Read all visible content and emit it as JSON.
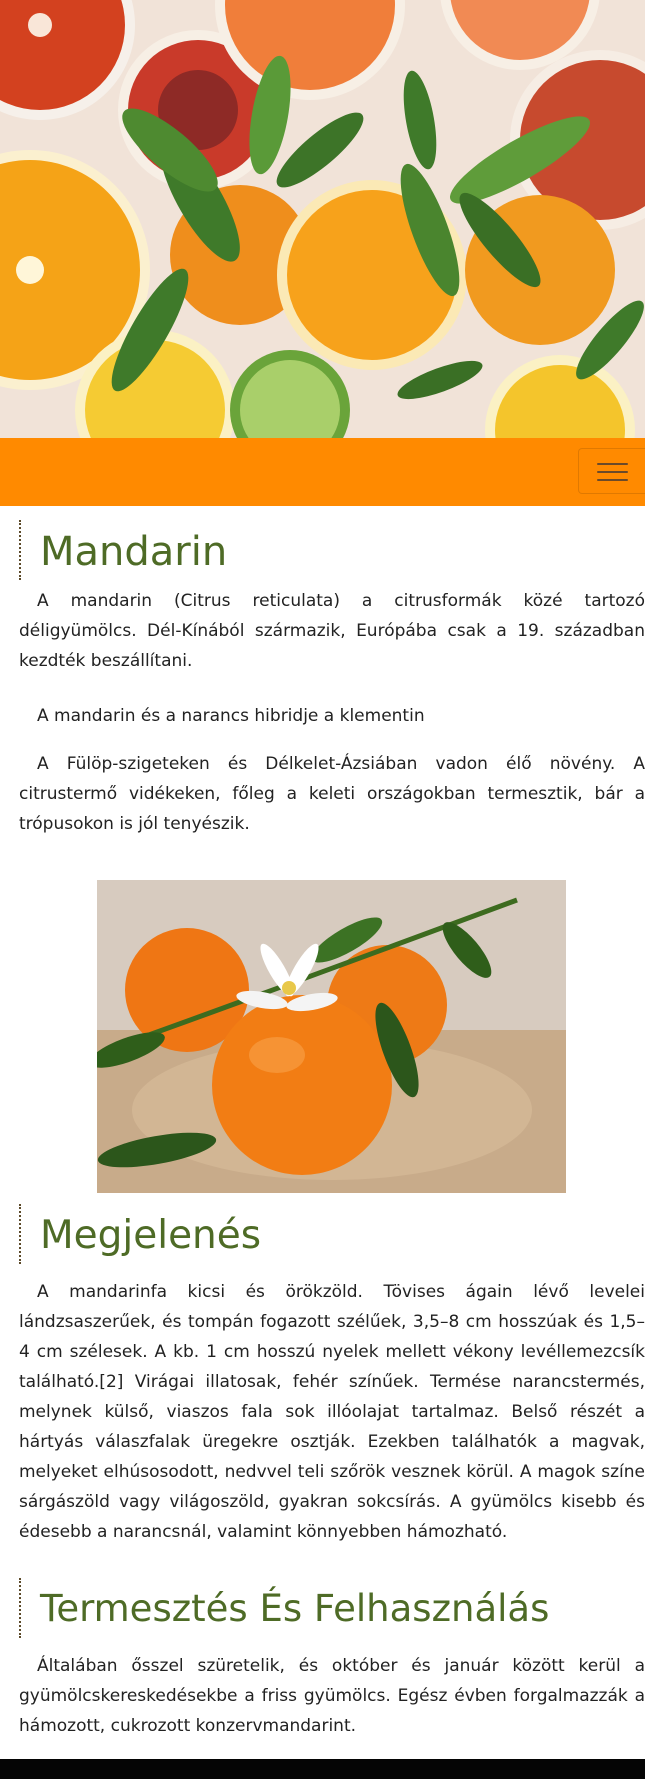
{
  "hero": {
    "image_alt": "Citrus fruits",
    "bg_color": "#f2e6dd"
  },
  "navbar": {
    "bg_color": "#ff8a00",
    "toggle_icon": "hamburger-menu-icon"
  },
  "sections": [
    {
      "title": "Mandarin",
      "paragraphs": [
        "A mandarin (Citrus reticulata) a citrusformák közé tartozó déligyümölcs. Dél-Kínából származik, Európába csak a 19. században kezdték beszállítani.",
        "A mandarin és a narancs hibridje a klementin",
        "A Fülöp-szigeteken és Délkelet-Ázsiában vadon élő növény. A citrustermő vidékeken, főleg a keleti országokban termesztik, bár a trópusokon is jól tenyészik."
      ]
    },
    {
      "title": "Megjelenés",
      "paragraphs": [
        "A mandarinfa kicsi és örökzöld. Tövises ágain lévő levelei lándzsaszerűek, és tompán fogazott szélűek, 3,5–8 cm hosszúak és 1,5–4 cm szélesek. A kb. 1 cm hosszú nyelek mellett vékony levéllemezcsík található.[2] Virágai illatosak, fehér színűek. Termése narancstermés, melynek külső, viaszos fala sok illóolajat tartalmaz. Belső részét a hártyás válaszfalak üregekre osztják. Ezekben találhatók a magvak, melyeket elhúsosodott, nedvvel teli szőrök vesznek körül. A magok színe sárgászöld vagy világoszöld, gyakran sokcsírás. A gyümölcs kisebb és édesebb a narancsnál, valamint könnyebben hámozható."
      ]
    },
    {
      "title": "Termesztés És Felhasználás",
      "paragraphs": [
        "Általában ősszel szüretelik, és október és január között kerül a gyümölcskereskedésekbe a friss gyümölcs. Egész évben forgalmazzák a hámozott, cukrozott konzervmandarint."
      ]
    }
  ],
  "photo": {
    "image_alt": "Mandarins with blossom"
  },
  "colors": {
    "heading": "#4e6b26",
    "accent": "#ff8a00",
    "text": "#222222"
  }
}
